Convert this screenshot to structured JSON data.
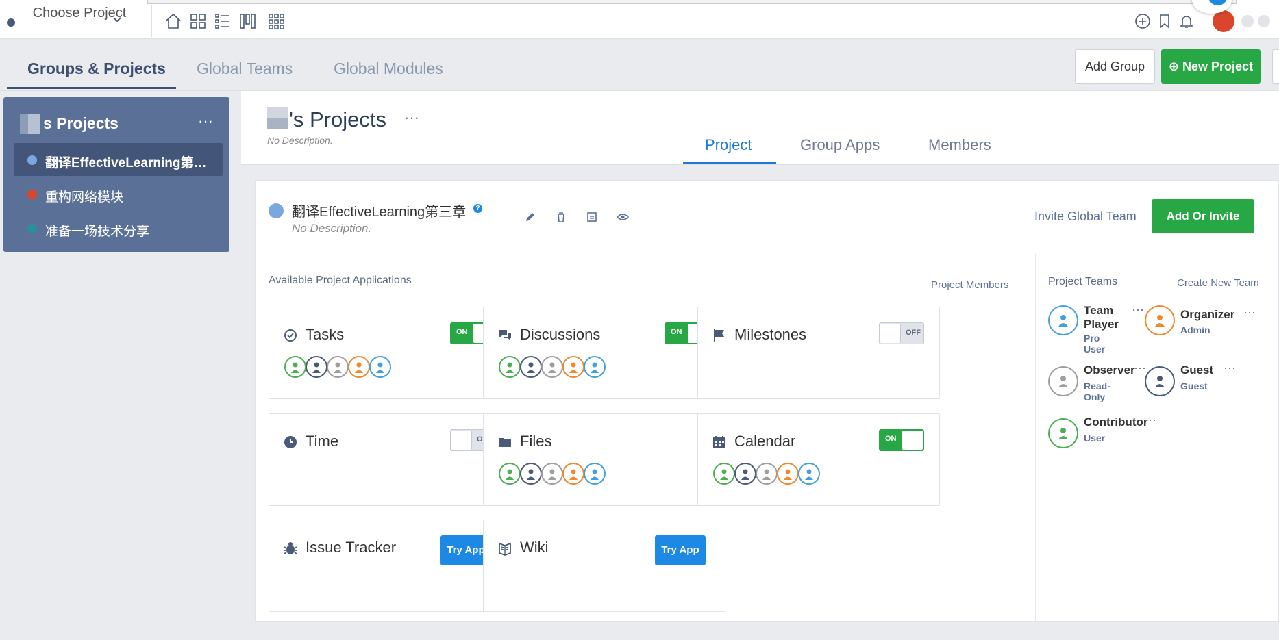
{
  "topbar": {
    "choose_project": "Choose Project",
    "icons": [
      "home-icon",
      "grid-icon",
      "list-icon",
      "columns-icon",
      "apps-icon"
    ],
    "right_icons": [
      "add-circle-icon",
      "bookmark-icon",
      "bell-icon"
    ]
  },
  "subnav": {
    "tabs": [
      {
        "label": "Groups & Projects",
        "active": true
      },
      {
        "label": "Global Teams",
        "active": false
      },
      {
        "label": "Global Modules",
        "active": false
      }
    ],
    "add_group": "Add Group",
    "new_project": "New Project"
  },
  "sidebar": {
    "title": "s Projects",
    "more": "···",
    "items": [
      {
        "label": "翻译EffectiveLearning第三章",
        "color": "#7aa7dd",
        "active": true
      },
      {
        "label": "重构网络模块",
        "color": "#d9462b",
        "active": false
      },
      {
        "label": "准备一场技术分享",
        "color": "#2e8d9a",
        "active": false
      }
    ]
  },
  "header": {
    "title": "'s Projects",
    "more": "···",
    "description": "No Description.",
    "tabs": [
      {
        "label": "Project",
        "active": true
      },
      {
        "label": "Group Apps",
        "active": false
      },
      {
        "label": "Members",
        "active": false
      }
    ]
  },
  "project": {
    "name": "翻译EffectiveLearning第三章",
    "help": "?",
    "description": "No Description.",
    "color": "#7aa7dd",
    "actions": [
      "edit-icon",
      "trash-icon",
      "archive-icon",
      "eye-icon"
    ],
    "invite_global_team": "Invite Global Team",
    "add_or_invite_users": "Add Or Invite Users"
  },
  "apps": {
    "title": "Available Project Applications",
    "project_members_link": "Project Members",
    "items": [
      {
        "name": "Tasks",
        "icon": "check-circle-icon",
        "state": "ON",
        "members": true
      },
      {
        "name": "Discussions",
        "icon": "chat-icon",
        "state": "ON",
        "members": true
      },
      {
        "name": "Milestones",
        "icon": "flag-icon",
        "state": "OFF",
        "members": false
      },
      {
        "name": "Time",
        "icon": "clock-icon",
        "state": "OFF",
        "members": false
      },
      {
        "name": "Files",
        "icon": "folder-icon",
        "state": null,
        "members": true
      },
      {
        "name": "Calendar",
        "icon": "calendar-icon",
        "state": "ON",
        "members": true
      },
      {
        "name": "Issue Tracker",
        "icon": "bug-icon",
        "try": "Try App",
        "members": false
      },
      {
        "name": "Wiki",
        "icon": "book-icon",
        "try": "Try App",
        "members": false
      }
    ],
    "member_colors": [
      "#4caf50",
      "#4a5a77",
      "#9e9e9e",
      "#f0882c",
      "#42a0dc"
    ]
  },
  "teams": {
    "title": "Project Teams",
    "create_link": "Create New Team",
    "items": [
      {
        "name": "Team Player",
        "role": "Pro User",
        "color": "#42a0dc"
      },
      {
        "name": "Organizer",
        "role": "Admin",
        "color": "#f0882c"
      },
      {
        "name": "Observer",
        "role": "Read-Only",
        "color": "#9e9e9e"
      },
      {
        "name": "Guest",
        "role": "Guest",
        "color": "#4a5a77"
      },
      {
        "name": "Contributor",
        "role": "User",
        "color": "#4caf50"
      }
    ],
    "more": "···"
  }
}
